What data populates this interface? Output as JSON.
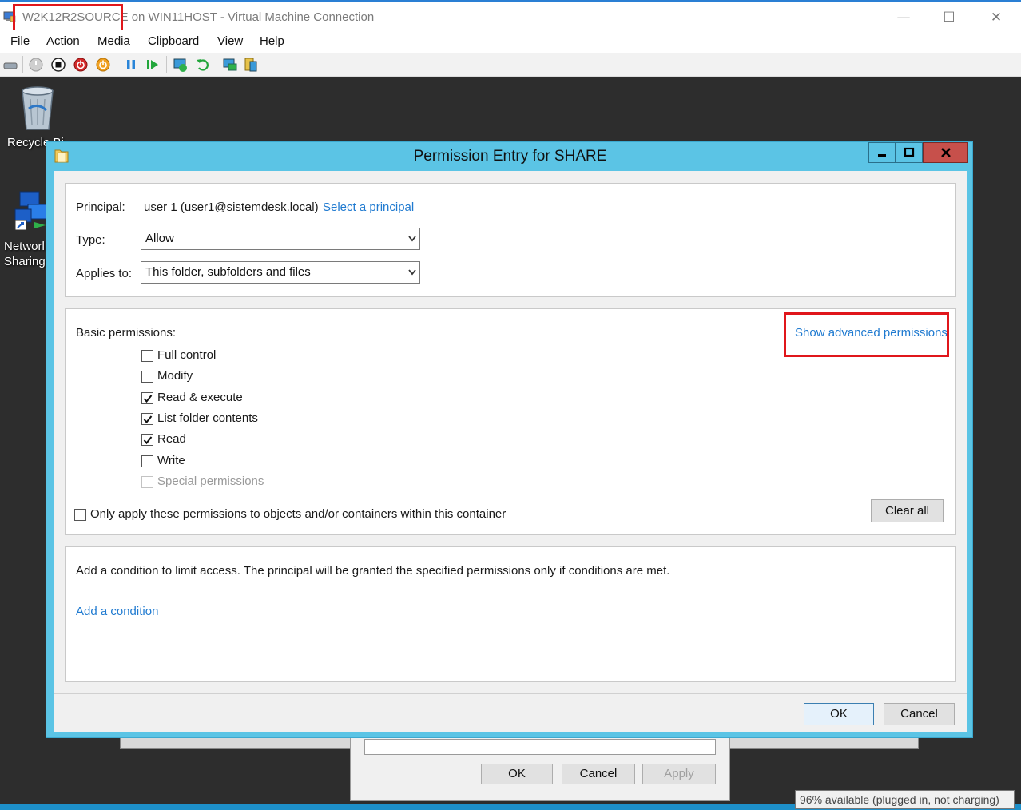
{
  "host": {
    "title": "W2K12R2SOURCE on WIN11HOST - Virtual Machine Connection",
    "menu": [
      "File",
      "Action",
      "Media",
      "Clipboard",
      "View",
      "Help"
    ],
    "toolbar_icons": [
      "ctrl-alt-del-icon",
      "start-icon",
      "turn-off-icon",
      "shut-down-icon",
      "save-icon",
      "pause-icon",
      "resume-icon",
      "checkpoint-icon",
      "revert-icon",
      "enhanced-session-icon",
      "share-icon"
    ]
  },
  "desktop": {
    "icons": [
      {
        "label": "Recycle Bi"
      },
      {
        "label_line1": "Networl",
        "label_line2": "Sharing"
      }
    ]
  },
  "dialog": {
    "title": "Permission Entry for SHARE",
    "principal_label": "Principal:",
    "principal_value": "user 1 (user1@sistemdesk.local)",
    "select_principal_link": "Select a principal",
    "type_label": "Type:",
    "type_value": "Allow",
    "applies_label": "Applies to:",
    "applies_value": "This folder, subfolders and files",
    "basic_permissions_label": "Basic permissions:",
    "show_advanced_link": "Show advanced permissions",
    "permissions": [
      {
        "label": "Full control",
        "checked": false,
        "enabled": true
      },
      {
        "label": "Modify",
        "checked": false,
        "enabled": true
      },
      {
        "label": "Read & execute",
        "checked": true,
        "enabled": true
      },
      {
        "label": "List folder contents",
        "checked": true,
        "enabled": true
      },
      {
        "label": "Read",
        "checked": true,
        "enabled": true
      },
      {
        "label": "Write",
        "checked": false,
        "enabled": true
      },
      {
        "label": "Special permissions",
        "checked": false,
        "enabled": false
      }
    ],
    "only_apply_label": "Only apply these permissions to objects and/or containers within this container",
    "only_apply_checked": false,
    "clear_all_label": "Clear all",
    "condition_text": "Add a condition to limit access. The principal will be granted the specified permissions only if conditions are met.",
    "add_condition_link": "Add a condition",
    "ok_label": "OK",
    "cancel_label": "Cancel"
  },
  "background_dialog": {
    "ok_label": "OK",
    "cancel_label": "Cancel",
    "apply_label": "Apply"
  },
  "battery_tooltip": "96% available (plugged in, not charging)",
  "colors": {
    "highlight": "#e0161b",
    "link": "#1f7ad0",
    "dialog_frame": "#5bc4e5",
    "close_button": "#c7504b"
  }
}
